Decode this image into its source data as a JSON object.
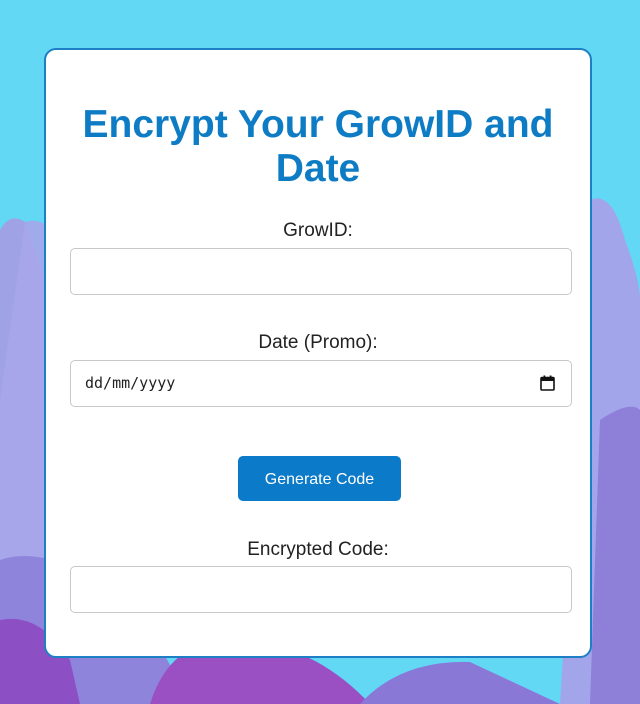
{
  "form": {
    "title": "Encrypt Your GrowID and Date",
    "growid": {
      "label": "GrowID:",
      "value": ""
    },
    "date": {
      "label": "Date (Promo):",
      "placeholder": "dd/mm/yyyy",
      "icon": "calendar-icon"
    },
    "generate_button": "Generate Code",
    "encrypted": {
      "label": "Encrypted Code:",
      "value": ""
    }
  },
  "colors": {
    "background_top": "#62d8f4",
    "background_shapes": "#8e7fd8",
    "accent": "#0b7ac9",
    "title": "#0e7cc4",
    "card_border": "#1d7fc6"
  }
}
